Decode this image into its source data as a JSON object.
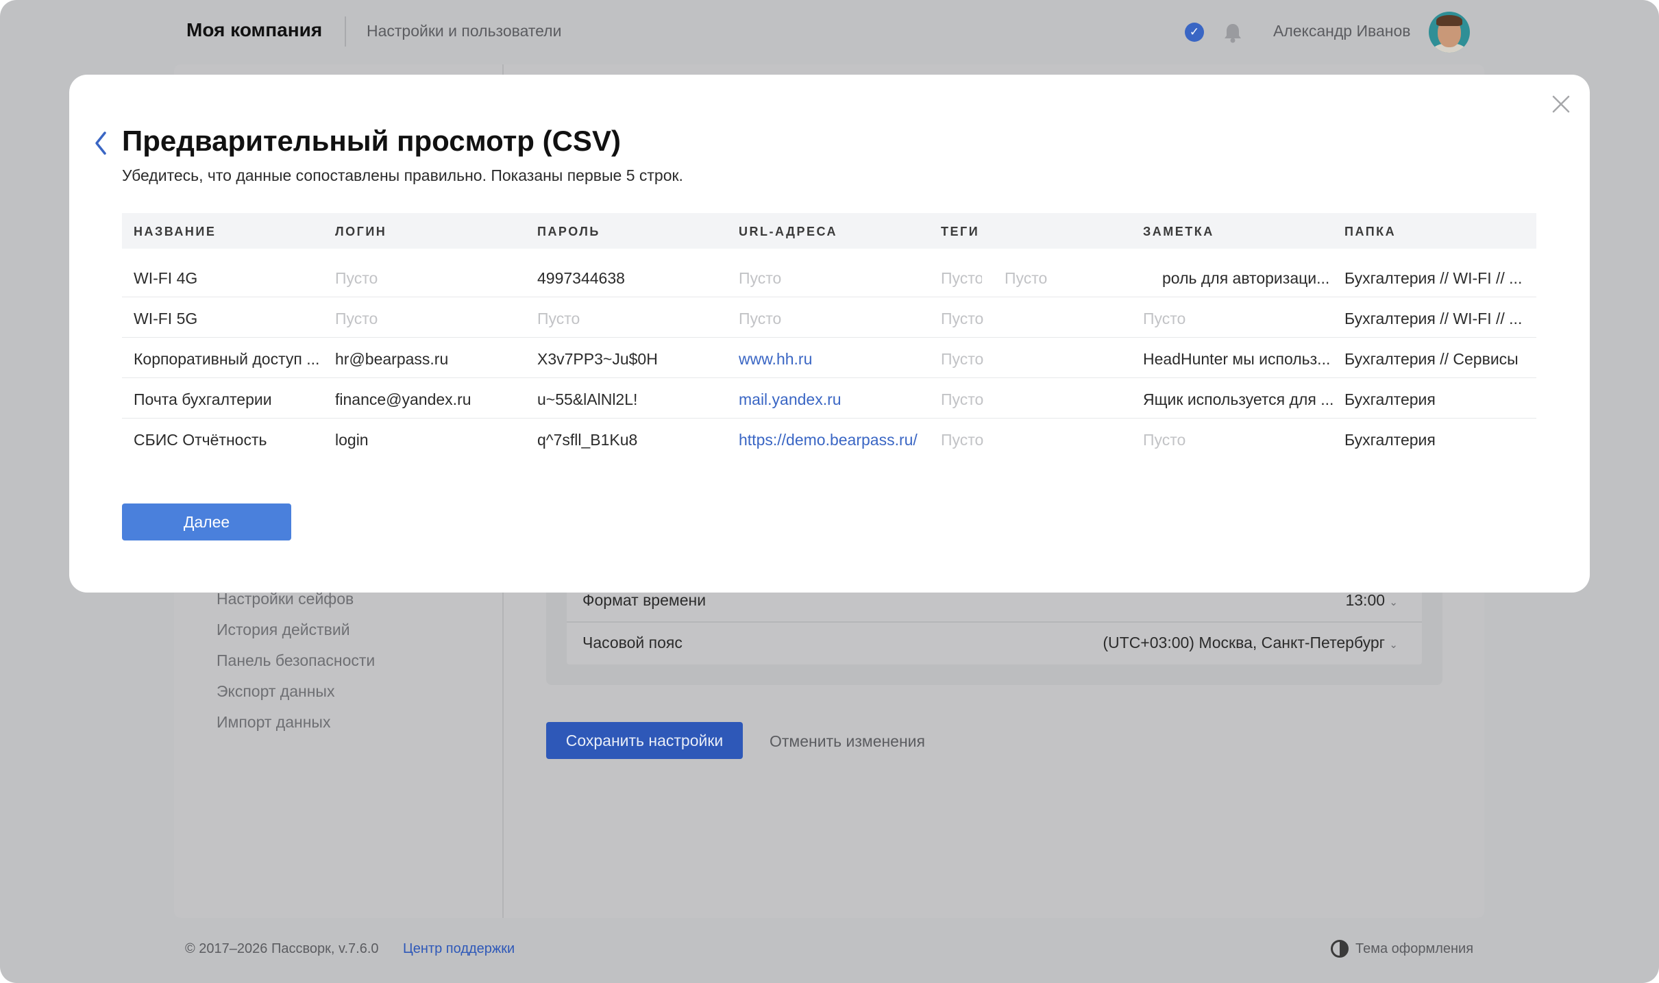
{
  "header": {
    "company": "Моя компания",
    "nav": "Настройки и пользователи",
    "user_name": "Александр Иванов"
  },
  "sidebar": {
    "items": [
      {
        "label": "Настройки сейфов"
      },
      {
        "label": "История действий"
      },
      {
        "label": "Панель безопасности"
      },
      {
        "label": "Экспорт данных"
      },
      {
        "label": "Импорт данных"
      }
    ]
  },
  "settings": {
    "time_format_label": "Формат времени",
    "time_format_value": "13:00",
    "timezone_label": "Часовой пояс",
    "timezone_value": "(UTC+03:00) Москва, Санкт-Петербург",
    "save_label": "Сохранить настройки",
    "cancel_label": "Отменить изменения"
  },
  "footer": {
    "copyright": "© 2017–2026 Пассворк, v.7.6.0",
    "support": "Центр поддержки",
    "theme": "Тема оформления"
  },
  "modal": {
    "title": "Предварительный просмотр (CSV)",
    "subtitle": "Убедитесь, что данные сопоставлены правильно. Показаны первые 5 строк.",
    "next_label": "Далее",
    "columns": [
      "НАЗВАНИЕ",
      "ЛОГИН",
      "ПАРОЛЬ",
      "URL-АДРЕСА",
      "ТЕГИ",
      "ЗАМЕТКА",
      "ПАПКА"
    ],
    "rows": [
      {
        "name": "WI-FI 4G",
        "login": "Пусто",
        "password": "4997344638",
        "url": "Пусто",
        "tags": "Пусто",
        "tags2": "Пусто",
        "note": "роль для авторизаци...",
        "folder": "Бухгалтерия // WI-FI // ..."
      },
      {
        "name": "WI-FI 5G",
        "login": "Пусто",
        "password": "Пусто",
        "url": "Пусто",
        "tags": "Пусто",
        "note": "Пусто",
        "folder": "Бухгалтерия // WI-FI // ..."
      },
      {
        "name": "Корпоративный доступ ...",
        "login": "hr@bearpass.ru",
        "password": "X3v7PP3~Ju$0H",
        "url": "www.hh.ru",
        "tags": "Пусто",
        "note": "HeadHunter мы использ...",
        "folder": "Бухгалтерия // Сервисы"
      },
      {
        "name": "Почта бухгалтерии",
        "login": "finance@yandex.ru",
        "password": "u~55&lAlNl2L!",
        "url": "mail.yandex.ru",
        "tags": "Пусто",
        "note": "Ящик используется для ...",
        "folder": "Бухгалтерия"
      },
      {
        "name": "СБИС Отчётность",
        "login": "login",
        "password": "q^7sfll_B1Ku8",
        "url": "https://demo.bearpass.ru/",
        "tags": "Пусто",
        "note": "Пусто",
        "folder": "Бухгалтерия"
      }
    ]
  }
}
